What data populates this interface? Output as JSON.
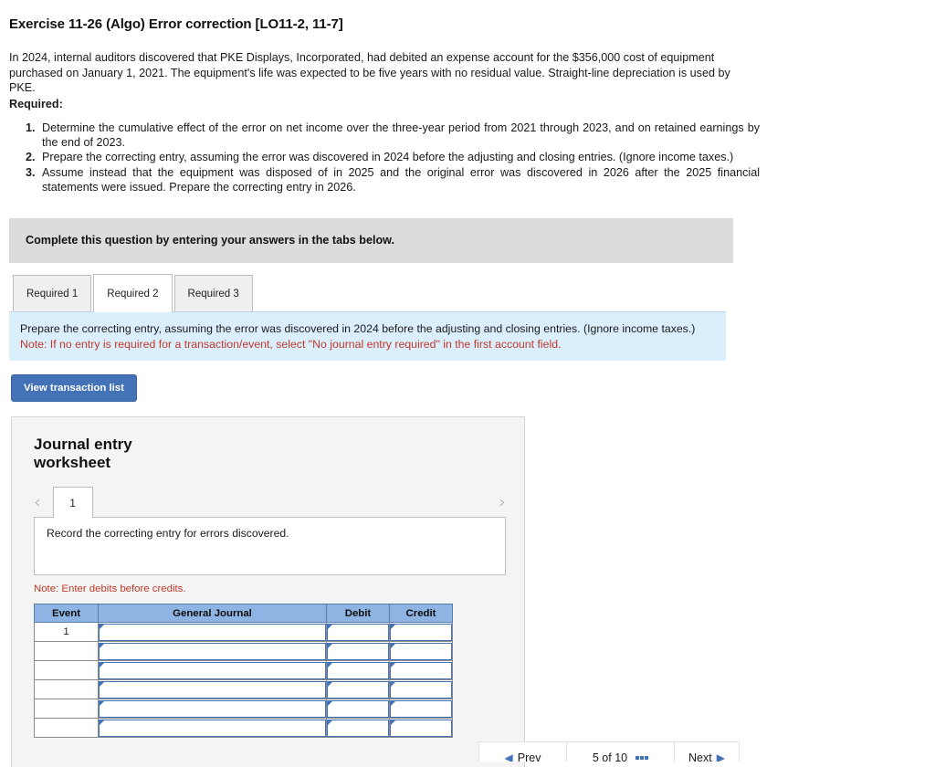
{
  "exercise": {
    "title": "Exercise 11-26 (Algo) Error correction [LO11-2, 11-7]",
    "statement": "In 2024, internal auditors discovered that PKE Displays, Incorporated, had debited an expense account for the $356,000 cost of equipment purchased on January 1, 2021. The equipment's life was expected to be five years with no residual value. Straight-line depreciation is used by PKE.",
    "required_label": "Required:",
    "requirements": [
      "Determine the cumulative effect of the error on net income over the three-year period from 2021 through 2023, and on retained earnings by the end of 2023.",
      "Prepare the correcting entry, assuming the error was discovered in 2024 before the adjusting and closing entries. (Ignore income taxes.)",
      "Assume instead that the equipment was disposed of in 2025 and the original error was discovered in 2026 after the 2025 financial statements were issued. Prepare the correcting entry in 2026."
    ]
  },
  "complete_bar": {
    "text": "Complete this question by entering your answers in the tabs below."
  },
  "tabs": [
    {
      "label": "Required 1",
      "active": false
    },
    {
      "label": "Required 2",
      "active": true
    },
    {
      "label": "Required 3",
      "active": false
    }
  ],
  "req_panel": {
    "instruction": "Prepare the correcting entry, assuming the error was discovered in 2024 before the adjusting and closing entries. (Ignore income taxes.)",
    "note": "Note: If no entry is required for a transaction/event, select \"No journal entry required\" in the first account field."
  },
  "view_button": {
    "label": "View transaction list"
  },
  "worksheet": {
    "title": "Journal entry worksheet",
    "prev_icon": "chevron-left-icon",
    "next_icon": "chevron-right-icon",
    "page_tab": "1",
    "description": "Record the correcting entry for errors discovered.",
    "debits_note": "Note: Enter debits before credits.",
    "table": {
      "columns": [
        "Event",
        "General Journal",
        "Debit",
        "Credit"
      ],
      "rows": [
        {
          "event": "1",
          "general_journal": "",
          "debit": "",
          "credit": ""
        },
        {
          "event": "",
          "general_journal": "",
          "debit": "",
          "credit": ""
        },
        {
          "event": "",
          "general_journal": "",
          "debit": "",
          "credit": ""
        },
        {
          "event": "",
          "general_journal": "",
          "debit": "",
          "credit": ""
        },
        {
          "event": "",
          "general_journal": "",
          "debit": "",
          "credit": ""
        },
        {
          "event": "",
          "general_journal": "",
          "debit": "",
          "credit": ""
        }
      ]
    }
  },
  "bottom_bar": {
    "prev_label": "Prev",
    "page_indicator": "5 of 10",
    "next_label": "Next",
    "prev_icon": "arrow-left-icon",
    "next_icon": "arrow-right-icon",
    "grid_icon": "grid-icon"
  },
  "colors": {
    "accent_blue": "#4472b6",
    "table_header_blue": "#8db4e2",
    "panel_blue": "#dbeefb",
    "note_red": "#c0392b",
    "gray_bar": "#dcdcdc"
  }
}
